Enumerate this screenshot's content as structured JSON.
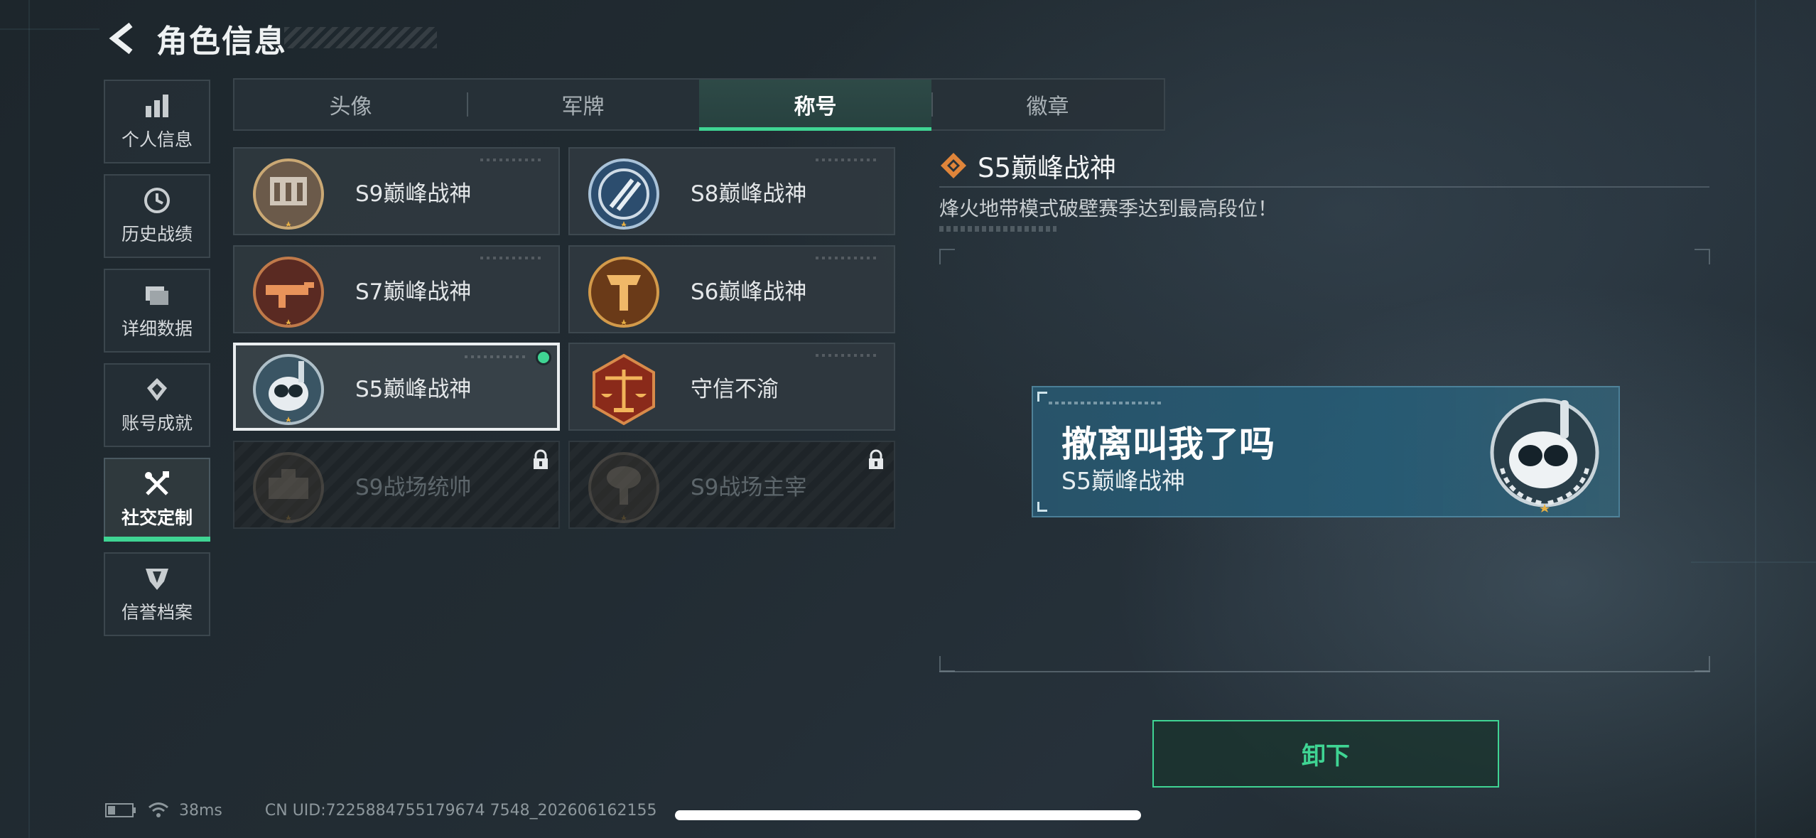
{
  "header": {
    "title": "角色信息"
  },
  "sidebar": {
    "items": [
      {
        "label": "个人信息",
        "icon": "bar-chart-icon"
      },
      {
        "label": "历史战绩",
        "icon": "clock-icon"
      },
      {
        "label": "详细数据",
        "icon": "folder-icon"
      },
      {
        "label": "账号成就",
        "icon": "medal-icon"
      },
      {
        "label": "社交定制",
        "icon": "tools-icon",
        "active": true
      },
      {
        "label": "信誉档案",
        "icon": "shield-icon"
      }
    ]
  },
  "tabs": [
    {
      "label": "头像"
    },
    {
      "label": "军牌"
    },
    {
      "label": "称号",
      "active": true
    },
    {
      "label": "徽章"
    }
  ],
  "titles": [
    {
      "label": "S9巅峰战神",
      "state": "owned"
    },
    {
      "label": "S8巅峰战神",
      "state": "owned"
    },
    {
      "label": "S7巅峰战神",
      "state": "owned"
    },
    {
      "label": "S6巅峰战神",
      "state": "owned"
    },
    {
      "label": "S5巅峰战神",
      "state": "equipped-selected"
    },
    {
      "label": "守信不渝",
      "state": "owned"
    },
    {
      "label": "S9战场统帅",
      "state": "locked"
    },
    {
      "label": "S9战场主宰",
      "state": "locked"
    }
  ],
  "detail": {
    "name": "S5巅峰战神",
    "description": "烽火地带模式破壁赛季达到最高段位！"
  },
  "nameplate": {
    "player_name": "撤离叫我了吗",
    "title": "S5巅峰战神"
  },
  "actions": {
    "unequip_label": "卸下"
  },
  "status": {
    "ping": "38ms",
    "uid": "CN UID:7225884755179674 7548_202606162155"
  },
  "colors": {
    "accent": "#3fd493",
    "background": "#222c33",
    "nameplate": "#2b5a72"
  }
}
